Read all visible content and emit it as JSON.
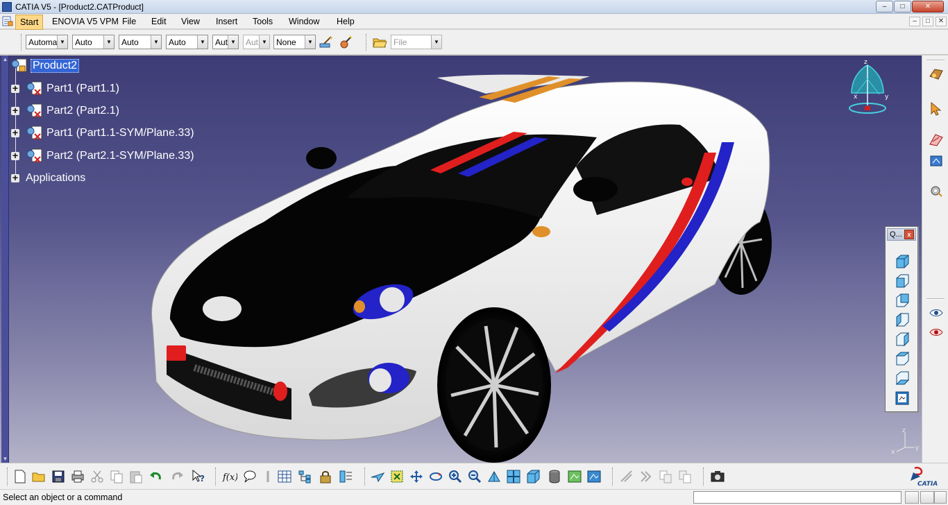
{
  "window": {
    "title": "CATIA V5 - [Product2.CATProduct]",
    "controls": {
      "minimize": "–",
      "maximize": "□",
      "close": "✕"
    }
  },
  "menu": {
    "items": [
      "Start",
      "ENOVIA V5 VPM",
      "File",
      "Edit",
      "View",
      "Insert",
      "Tools",
      "Window",
      "Help"
    ],
    "mdi_controls": [
      "–",
      "□",
      "✕"
    ]
  },
  "graphic_properties_toolbar": {
    "combos": [
      {
        "name": "color",
        "value": "Automa",
        "enabled": true
      },
      {
        "name": "transparency",
        "value": "Auto",
        "enabled": true
      },
      {
        "name": "linetype",
        "value": "Auto",
        "enabled": true
      },
      {
        "name": "thickness",
        "value": "Auto",
        "enabled": true
      },
      {
        "name": "point-symbol",
        "value": "Aut",
        "enabled": true
      },
      {
        "name": "layer-filter",
        "value": "Aut",
        "enabled": false
      },
      {
        "name": "layer",
        "value": "None",
        "enabled": true
      },
      {
        "name": "file-combo",
        "value": "File",
        "enabled": false
      }
    ],
    "combo_arrow": "▼"
  },
  "spec_tree": {
    "root": "Product2",
    "children": [
      {
        "label": "Part1 (Part1.1)",
        "type": "part"
      },
      {
        "label": "Part2 (Part2.1)",
        "type": "part"
      },
      {
        "label": "Part1 (Part1.1-SYM/Plane.33)",
        "type": "part"
      },
      {
        "label": "Part2 (Part2.1-SYM/Plane.33)",
        "type": "part"
      },
      {
        "label": "Applications",
        "type": "folder"
      }
    ],
    "expander": "+"
  },
  "compass": {
    "x_label": "x",
    "y_label": "y",
    "z_label": "z"
  },
  "axis_indicator": {
    "x_label": "x",
    "y_label": "y",
    "z_label": "z"
  },
  "quick_view_toolbar": {
    "title": "Q...",
    "close": "x",
    "buttons": [
      "isometric-view",
      "front-view",
      "back-view",
      "left-view",
      "right-view",
      "top-view",
      "bottom-view",
      "named-views"
    ]
  },
  "right_toolbar": {
    "icons": [
      "product-structure-icon",
      "select-icon",
      "sketch-icon",
      "constraint-icon",
      "gear-icon",
      "hide-show-icon",
      "swap-visible-space-icon"
    ]
  },
  "bottom_toolbar": {
    "icons": [
      "new-icon",
      "open-icon",
      "save-icon",
      "print-icon",
      "cut-icon",
      "copy-icon",
      "paste-icon",
      "undo-icon",
      "redo-icon",
      "whats-this-icon",
      "formula-icon",
      "comment-icon",
      "measure-icon",
      "table-icon",
      "tree-icon",
      "lock-icon",
      "catalog-icon",
      "fly-mode-icon",
      "fit-all-icon",
      "pan-icon",
      "rotate-icon",
      "zoom-in-icon",
      "zoom-out-icon",
      "normal-view-icon",
      "multi-view-icon",
      "isometric-icon",
      "render-style-icon",
      "create-view-icon",
      "hide-show-icon",
      "snap-icon",
      "spin-icon",
      "copy-props-icon",
      "paste-props-icon",
      "capture-icon"
    ]
  },
  "brand": {
    "name": "CATIA"
  },
  "status_bar": {
    "message": "Select an object or a command"
  },
  "colors": {
    "background_top": "#3d3c76",
    "background_bottom": "#b4b3c9",
    "selection": "#3465d6",
    "car_body": "#f2f2f2",
    "stripe_red": "#e01e1e",
    "stripe_blue": "#2323c8",
    "stripe_orange": "#e0902a"
  }
}
